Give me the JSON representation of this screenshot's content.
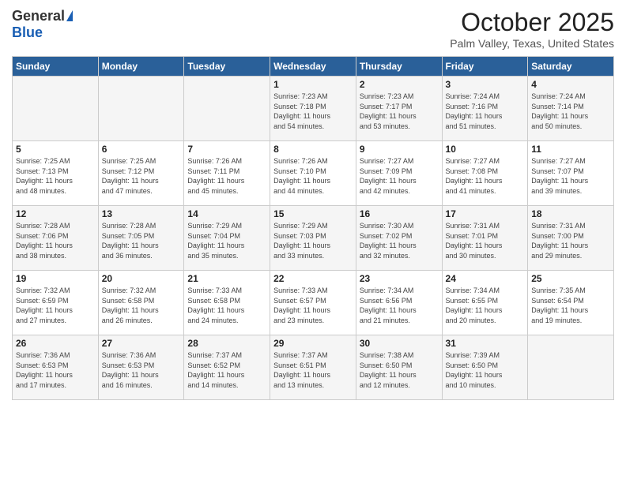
{
  "header": {
    "logo_general": "General",
    "logo_blue": "Blue",
    "month_title": "October 2025",
    "location": "Palm Valley, Texas, United States"
  },
  "days_of_week": [
    "Sunday",
    "Monday",
    "Tuesday",
    "Wednesday",
    "Thursday",
    "Friday",
    "Saturday"
  ],
  "weeks": [
    [
      {
        "day": "",
        "info": ""
      },
      {
        "day": "",
        "info": ""
      },
      {
        "day": "",
        "info": ""
      },
      {
        "day": "1",
        "info": "Sunrise: 7:23 AM\nSunset: 7:18 PM\nDaylight: 11 hours\nand 54 minutes."
      },
      {
        "day": "2",
        "info": "Sunrise: 7:23 AM\nSunset: 7:17 PM\nDaylight: 11 hours\nand 53 minutes."
      },
      {
        "day": "3",
        "info": "Sunrise: 7:24 AM\nSunset: 7:16 PM\nDaylight: 11 hours\nand 51 minutes."
      },
      {
        "day": "4",
        "info": "Sunrise: 7:24 AM\nSunset: 7:14 PM\nDaylight: 11 hours\nand 50 minutes."
      }
    ],
    [
      {
        "day": "5",
        "info": "Sunrise: 7:25 AM\nSunset: 7:13 PM\nDaylight: 11 hours\nand 48 minutes."
      },
      {
        "day": "6",
        "info": "Sunrise: 7:25 AM\nSunset: 7:12 PM\nDaylight: 11 hours\nand 47 minutes."
      },
      {
        "day": "7",
        "info": "Sunrise: 7:26 AM\nSunset: 7:11 PM\nDaylight: 11 hours\nand 45 minutes."
      },
      {
        "day": "8",
        "info": "Sunrise: 7:26 AM\nSunset: 7:10 PM\nDaylight: 11 hours\nand 44 minutes."
      },
      {
        "day": "9",
        "info": "Sunrise: 7:27 AM\nSunset: 7:09 PM\nDaylight: 11 hours\nand 42 minutes."
      },
      {
        "day": "10",
        "info": "Sunrise: 7:27 AM\nSunset: 7:08 PM\nDaylight: 11 hours\nand 41 minutes."
      },
      {
        "day": "11",
        "info": "Sunrise: 7:27 AM\nSunset: 7:07 PM\nDaylight: 11 hours\nand 39 minutes."
      }
    ],
    [
      {
        "day": "12",
        "info": "Sunrise: 7:28 AM\nSunset: 7:06 PM\nDaylight: 11 hours\nand 38 minutes."
      },
      {
        "day": "13",
        "info": "Sunrise: 7:28 AM\nSunset: 7:05 PM\nDaylight: 11 hours\nand 36 minutes."
      },
      {
        "day": "14",
        "info": "Sunrise: 7:29 AM\nSunset: 7:04 PM\nDaylight: 11 hours\nand 35 minutes."
      },
      {
        "day": "15",
        "info": "Sunrise: 7:29 AM\nSunset: 7:03 PM\nDaylight: 11 hours\nand 33 minutes."
      },
      {
        "day": "16",
        "info": "Sunrise: 7:30 AM\nSunset: 7:02 PM\nDaylight: 11 hours\nand 32 minutes."
      },
      {
        "day": "17",
        "info": "Sunrise: 7:31 AM\nSunset: 7:01 PM\nDaylight: 11 hours\nand 30 minutes."
      },
      {
        "day": "18",
        "info": "Sunrise: 7:31 AM\nSunset: 7:00 PM\nDaylight: 11 hours\nand 29 minutes."
      }
    ],
    [
      {
        "day": "19",
        "info": "Sunrise: 7:32 AM\nSunset: 6:59 PM\nDaylight: 11 hours\nand 27 minutes."
      },
      {
        "day": "20",
        "info": "Sunrise: 7:32 AM\nSunset: 6:58 PM\nDaylight: 11 hours\nand 26 minutes."
      },
      {
        "day": "21",
        "info": "Sunrise: 7:33 AM\nSunset: 6:58 PM\nDaylight: 11 hours\nand 24 minutes."
      },
      {
        "day": "22",
        "info": "Sunrise: 7:33 AM\nSunset: 6:57 PM\nDaylight: 11 hours\nand 23 minutes."
      },
      {
        "day": "23",
        "info": "Sunrise: 7:34 AM\nSunset: 6:56 PM\nDaylight: 11 hours\nand 21 minutes."
      },
      {
        "day": "24",
        "info": "Sunrise: 7:34 AM\nSunset: 6:55 PM\nDaylight: 11 hours\nand 20 minutes."
      },
      {
        "day": "25",
        "info": "Sunrise: 7:35 AM\nSunset: 6:54 PM\nDaylight: 11 hours\nand 19 minutes."
      }
    ],
    [
      {
        "day": "26",
        "info": "Sunrise: 7:36 AM\nSunset: 6:53 PM\nDaylight: 11 hours\nand 17 minutes."
      },
      {
        "day": "27",
        "info": "Sunrise: 7:36 AM\nSunset: 6:53 PM\nDaylight: 11 hours\nand 16 minutes."
      },
      {
        "day": "28",
        "info": "Sunrise: 7:37 AM\nSunset: 6:52 PM\nDaylight: 11 hours\nand 14 minutes."
      },
      {
        "day": "29",
        "info": "Sunrise: 7:37 AM\nSunset: 6:51 PM\nDaylight: 11 hours\nand 13 minutes."
      },
      {
        "day": "30",
        "info": "Sunrise: 7:38 AM\nSunset: 6:50 PM\nDaylight: 11 hours\nand 12 minutes."
      },
      {
        "day": "31",
        "info": "Sunrise: 7:39 AM\nSunset: 6:50 PM\nDaylight: 11 hours\nand 10 minutes."
      },
      {
        "day": "",
        "info": ""
      }
    ]
  ]
}
